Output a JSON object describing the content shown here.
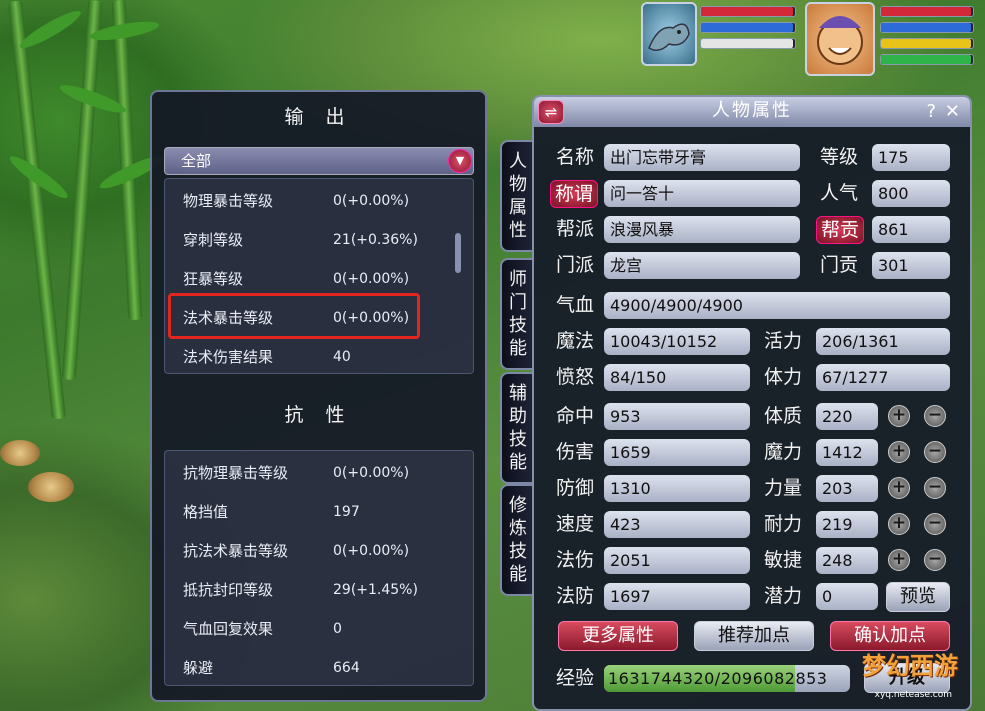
{
  "output_panel": {
    "title": "输 出",
    "filter": "全部",
    "rows": [
      {
        "label": "物理暴击等级",
        "value": "0(+0.00%)"
      },
      {
        "label": "穿刺等级",
        "value": "21(+0.36%)"
      },
      {
        "label": "狂暴等级",
        "value": "0(+0.00%)"
      },
      {
        "label": "法术暴击等级",
        "value": "0(+0.00%)"
      },
      {
        "label": "法术伤害结果",
        "value": "40"
      }
    ],
    "resist_title": "抗 性",
    "resist_rows": [
      {
        "label": "抗物理暴击等级",
        "value": "0(+0.00%)"
      },
      {
        "label": "格挡值",
        "value": "197"
      },
      {
        "label": "抗法术暴击等级",
        "value": "0(+0.00%)"
      },
      {
        "label": "抵抗封印等级",
        "value": "29(+1.45%)"
      },
      {
        "label": "气血回复效果",
        "value": "0"
      },
      {
        "label": "躲避",
        "value": "664"
      }
    ]
  },
  "side_tabs": [
    "人物属性",
    "师门技能",
    "辅助技能",
    "修炼技能"
  ],
  "attributes": {
    "title": "人物属性",
    "help": "?",
    "close": "✕",
    "swap": "⇌",
    "name_label": "名称",
    "name": "出门忘带牙膏",
    "level_label": "等级",
    "level": "175",
    "title_btn": "称谓",
    "title_value": "问一答十",
    "popularity_label": "人气",
    "popularity": "800",
    "guild_label": "帮派",
    "guild": "浪漫风暴",
    "contrib_btn": "帮贡",
    "contrib": "861",
    "school_label": "门派",
    "school": "龙宫",
    "school_contrib_label": "门贡",
    "school_contrib": "301",
    "hp_label": "气血",
    "hp": "4900/4900/4900",
    "mp_label": "魔法",
    "mp": "10043/10152",
    "vitality_label": "活力",
    "vitality": "206/1361",
    "anger_label": "愤怒",
    "anger": "84/150",
    "stamina_label": "体力",
    "stamina": "67/1277",
    "stats": [
      {
        "label": "命中",
        "value": "953",
        "attr_label": "体质",
        "attr_value": "220"
      },
      {
        "label": "伤害",
        "value": "1659",
        "attr_label": "魔力",
        "attr_value": "1412"
      },
      {
        "label": "防御",
        "value": "1310",
        "attr_label": "力量",
        "attr_value": "203"
      },
      {
        "label": "速度",
        "value": "423",
        "attr_label": "耐力",
        "attr_value": "219"
      },
      {
        "label": "法伤",
        "value": "2051",
        "attr_label": "敏捷",
        "attr_value": "248"
      },
      {
        "label": "法防",
        "value": "1697",
        "attr_label": "潜力",
        "attr_value": "0"
      }
    ],
    "preview_btn": "预览",
    "more_btn": "更多属性",
    "recommend_btn": "推荐加点",
    "confirm_btn": "确认加点",
    "exp_label": "经验",
    "exp": "1631744320/2096082853",
    "exp_ratio": 0.778,
    "upgrade_btn": "升级"
  },
  "hud": {
    "pet_bars": [
      0.98,
      0.98,
      0.98
    ],
    "player_bars": [
      0.98,
      0.98,
      0.98,
      0.98
    ]
  },
  "logo": {
    "text": "梦幻西游",
    "url": "xyq.netease.com"
  },
  "colors": {
    "highlight": "#e2261f",
    "accent_red": "#8a1830",
    "exp_fill": "#4d9a35"
  }
}
